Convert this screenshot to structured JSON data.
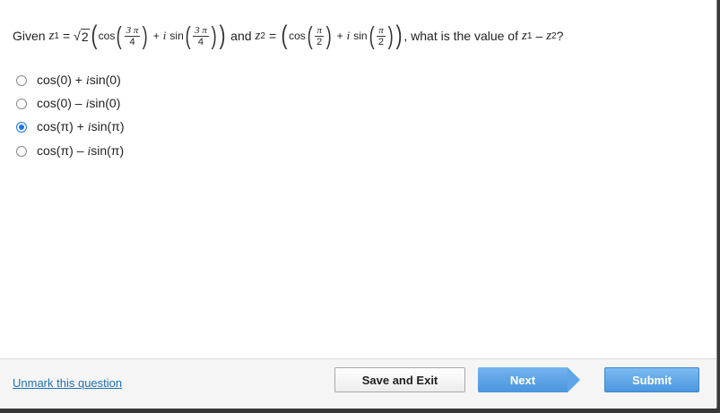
{
  "question": {
    "given": "Given",
    "z": "z",
    "sub1": "1",
    "sub2": "2",
    "eq": "=",
    "sqrt_sym": "√",
    "sqrt_arg": "2",
    "cos": "cos",
    "sin": "sin",
    "i": "i",
    "plus": "+",
    "three_pi": "3 π",
    "pi": "π",
    "four": "4",
    "two": "2",
    "and": "and",
    "tail": ", what is the value of",
    "minus": "–",
    "qmark": "?"
  },
  "options": [
    {
      "pre": "cos(0) + ",
      "i": "i",
      "post": "sin(0)",
      "checked": false
    },
    {
      "pre": "cos(0) – ",
      "i": "i",
      "post": "sin(0)",
      "checked": false
    },
    {
      "pre": "cos(π) + ",
      "i": "i",
      "post": "sin(π)",
      "checked": true
    },
    {
      "pre": "cos(π) – ",
      "i": "i",
      "post": "sin(π)",
      "checked": false
    }
  ],
  "footer": {
    "unmark_label": "Unmark this question",
    "save_label": "Save and Exit",
    "next_label": "Next",
    "submit_label": "Submit"
  },
  "colors": {
    "accent": "#4a95de",
    "link": "#1f6fb2"
  }
}
